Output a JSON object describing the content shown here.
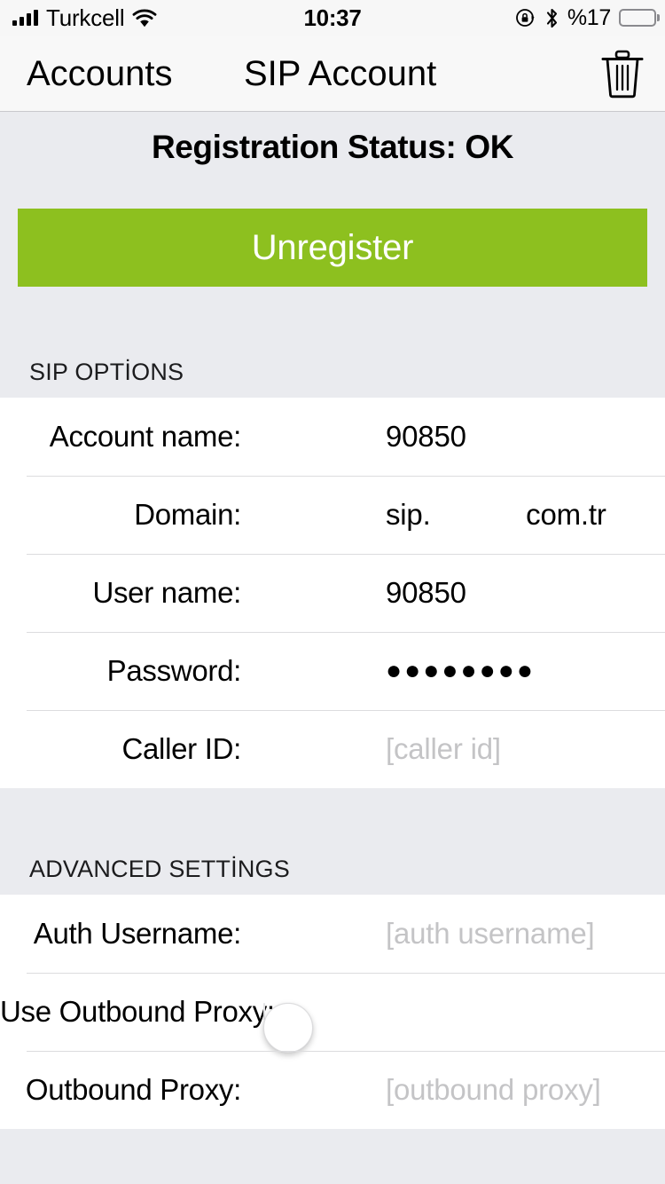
{
  "statusbar": {
    "carrier": "Turkcell",
    "time": "10:37",
    "battery_percent": "%17",
    "signal_icon": "signal-bars-icon",
    "wifi_icon": "wifi-icon",
    "rotation_lock_icon": "rotation-lock-icon",
    "bluetooth_icon": "bluetooth-icon",
    "battery_icon": "battery-low-icon",
    "battery_level": 17,
    "battery_color": "#FF3B30"
  },
  "navbar": {
    "back_label": "Accounts",
    "title": "SIP Account",
    "delete_icon": "trash-icon"
  },
  "status": {
    "registration_text": "Registration Status: OK"
  },
  "actions": {
    "unregister_label": "Unregister",
    "unregister_color": "#8DC01F"
  },
  "sections": [
    {
      "header": "SIP OPTİONS",
      "rows": [
        {
          "label": "Account name:",
          "value": "90850",
          "is_placeholder": false
        },
        {
          "label": "Domain:",
          "value": "sip.            com.tr",
          "is_placeholder": false
        },
        {
          "label": "User name:",
          "value": "90850",
          "is_placeholder": false
        },
        {
          "label": "Password:",
          "value": "●●●●●●●●",
          "is_placeholder": false
        },
        {
          "label": "Caller ID:",
          "value": "[caller id]",
          "is_placeholder": true
        }
      ]
    },
    {
      "header": "ADVANCED SETTİNGS",
      "rows": [
        {
          "label": "Auth Username:",
          "value": "[auth username]",
          "is_placeholder": true
        },
        {
          "label": "Use Outbound Proxy:",
          "value": "",
          "is_toggle": true,
          "toggle_on": false
        },
        {
          "label": "Outbound Proxy:",
          "value": "[outbound proxy]",
          "is_placeholder": true
        }
      ]
    }
  ]
}
